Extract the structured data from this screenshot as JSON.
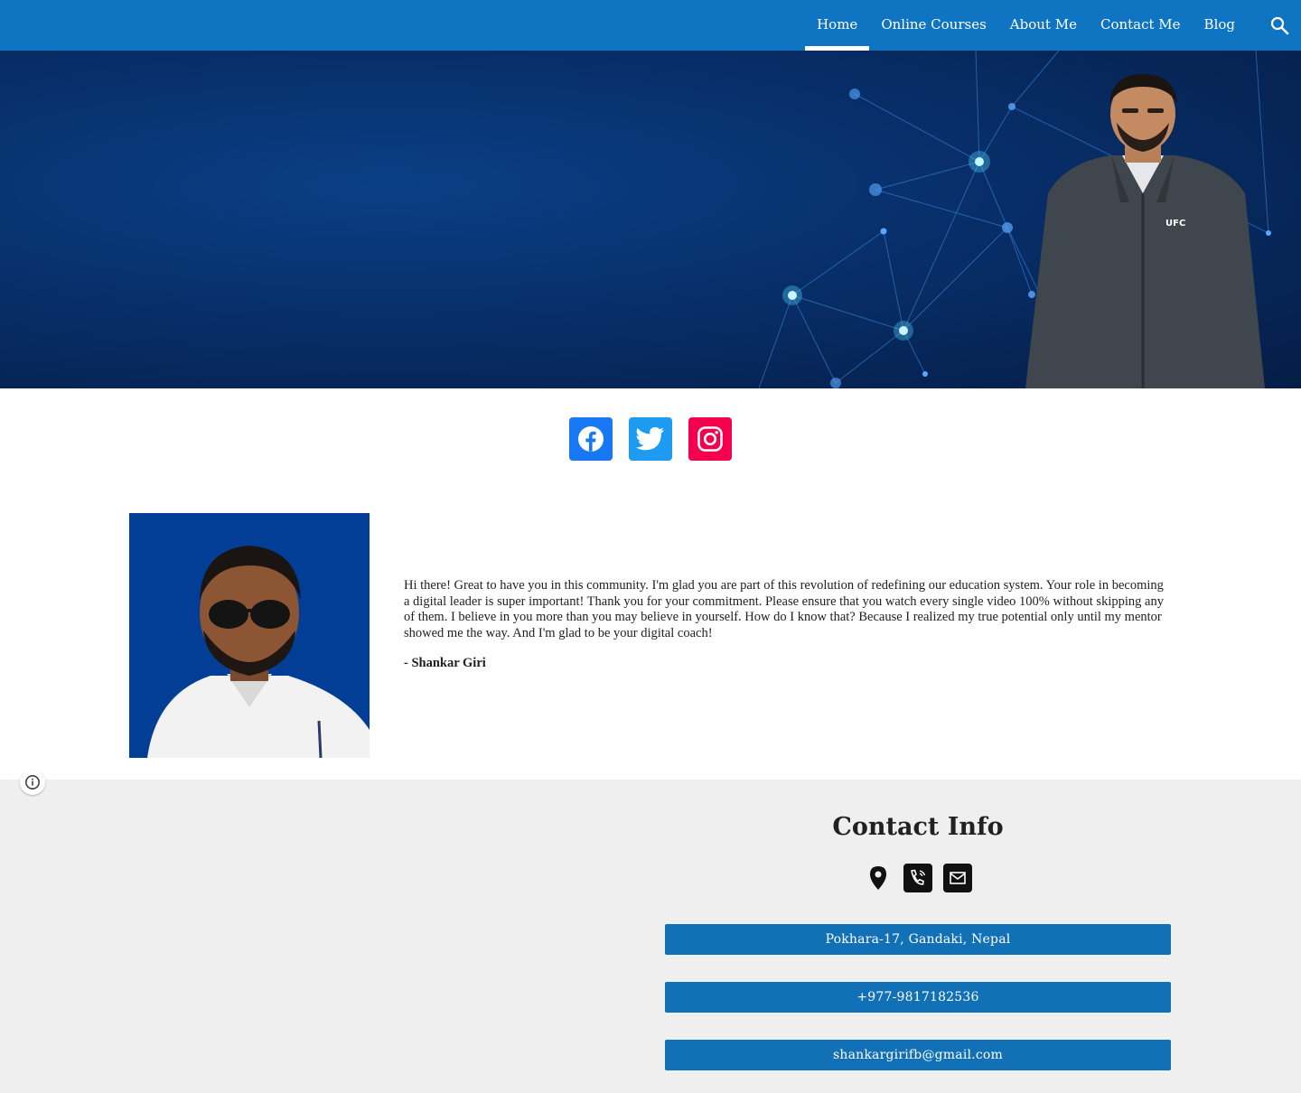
{
  "nav": {
    "items": [
      {
        "label": "Home",
        "active": true
      },
      {
        "label": "Online Courses",
        "active": false
      },
      {
        "label": "About Me",
        "active": false
      },
      {
        "label": "Contact Me",
        "active": false
      },
      {
        "label": "Blog",
        "active": false
      }
    ],
    "search_icon": "search-icon"
  },
  "colors": {
    "nav_bg": "#0f74c2",
    "hero_bg": "#082f6a",
    "facebook": "#1877f2",
    "twitter": "#1d9bf0",
    "instagram": "#f4004e",
    "contact_button": "#1271b6",
    "section_bg": "#efefef"
  },
  "social": [
    {
      "icon": "facebook-icon"
    },
    {
      "icon": "twitter-icon"
    },
    {
      "icon": "instagram-icon"
    }
  ],
  "hero": {
    "jacket_text": "UFC"
  },
  "intro": {
    "paragraph": "Hi there! Great to have you in this community.  I'm glad you are part of this revolution of redefining our education system. Your role in becoming a digital leader is super important! Thank you for your commitment.  Please ensure that you watch every single video 100% without skipping any of them.  I believe in you more than you may believe in yourself. How do I know that? Because I realized my true potential only until my mentor showed me the way. And I'm glad to be your digital coach!",
    "signature": "- Shankar Giri"
  },
  "contact": {
    "title": "Contact Info",
    "icons": [
      "location-pin-icon",
      "phone-icon",
      "mail-icon"
    ],
    "address": "Pokhara-17, Gandaki, Nepal",
    "phone": "+977-9817182536",
    "email": "shankargirifb@gmail.com"
  }
}
